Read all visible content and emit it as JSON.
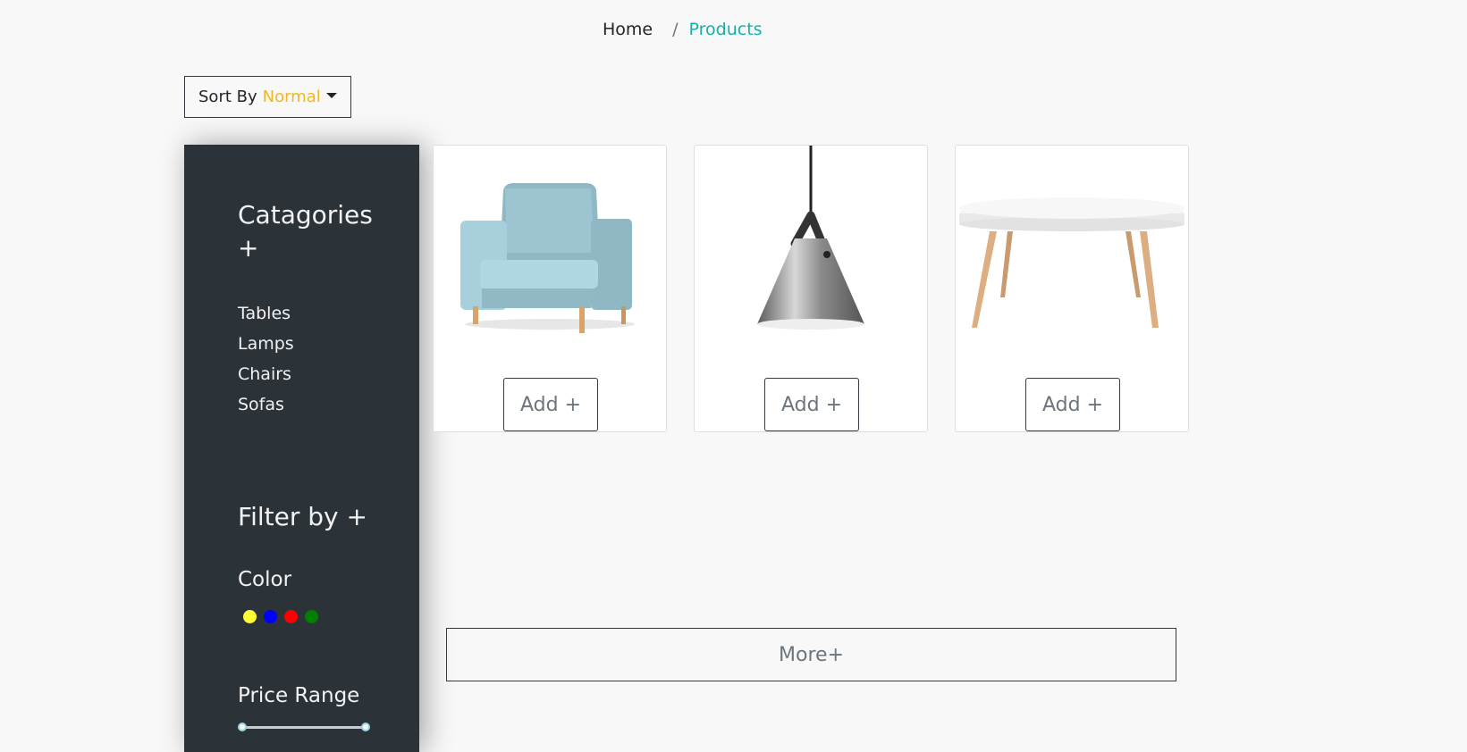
{
  "breadcrumb": {
    "home": "Home",
    "separator": "/",
    "current": "Products"
  },
  "sort": {
    "label": "Sort By",
    "value": "Normal"
  },
  "sidebar": {
    "categories_title": "Catagories +",
    "categories": [
      "Tables",
      "Lamps",
      "Chairs",
      "Sofas"
    ],
    "filter_title": "Filter by +",
    "color_title": "Color",
    "colors": [
      "#ffff33",
      "#0000ff",
      "#ff0000",
      "#008000"
    ],
    "price_title": "Price Range"
  },
  "products": [
    {
      "image": "armchair-icon",
      "button": "Add +"
    },
    {
      "image": "pendant-lamp-icon",
      "button": "Add +"
    },
    {
      "image": "round-table-icon",
      "button": "Add +"
    }
  ],
  "more_label": "More+",
  "colors": {
    "accent": "#17b0a8",
    "sort_value": "#f0b81c",
    "sidebar_bg": "#2b3238"
  }
}
